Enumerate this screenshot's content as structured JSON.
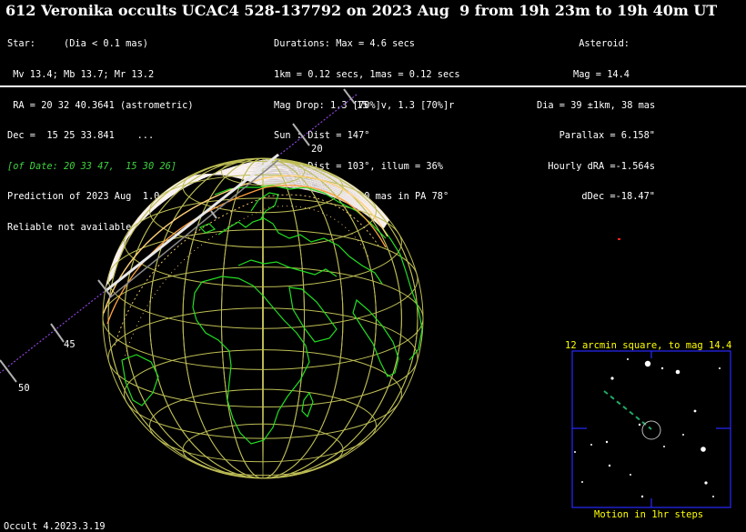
{
  "title": "612 Veronika occults UCAC4 528-137792 on 2023 Aug  9 from 19h 23m to 19h 40m UT",
  "star_col": [
    "Star:     (Dia < 0.1 mas)",
    " Mv 13.4; Mb 13.7; Mr 13.2",
    " RA = 20 32 40.3641 (astrometric)",
    "Dec =  15 25 33.841    ...",
    "[of Date: 20 33 47,  15 30 26]",
    "Prediction of 2023 Aug  1.0",
    "Reliable not available"
  ],
  "dur_col": [
    "Durations: Max = 4.6 secs",
    "1km = 0.12 secs, 1mas = 0.12 secs",
    "Mag Drop: 1.3 [70%]v, 1.3 [70%]r",
    "Sun : Dist = 147°",
    "Moon: Dist = 103°, illum = 36%",
    "Error 44.0 x 22.0 mas in PA 78°"
  ],
  "ast_col": [
    "Asteroid:",
    "Mag = 14.4",
    "Dia = 39 ±1km, 38 mas",
    "Parallax = 6.158\"",
    "Hourly dRA =-1.564s",
    "dDec =-18.47\""
  ],
  "path_labels": [
    "15",
    "20",
    "45",
    "50"
  ],
  "starchart": {
    "title": "12 arcmin square, to mag 14.4",
    "caption": "Motion in 1hr steps"
  },
  "footer": "Occult 4.2023.3.19",
  "colors": {
    "background": "#000000",
    "globe_grid": "#bdbd55",
    "coastline": "#22dd22",
    "path": "#ffffff",
    "path_edge": "#ffd27a",
    "track": "#8a44d8",
    "starchart_box": "#2828ff",
    "starchart_text": "#ffff00"
  }
}
